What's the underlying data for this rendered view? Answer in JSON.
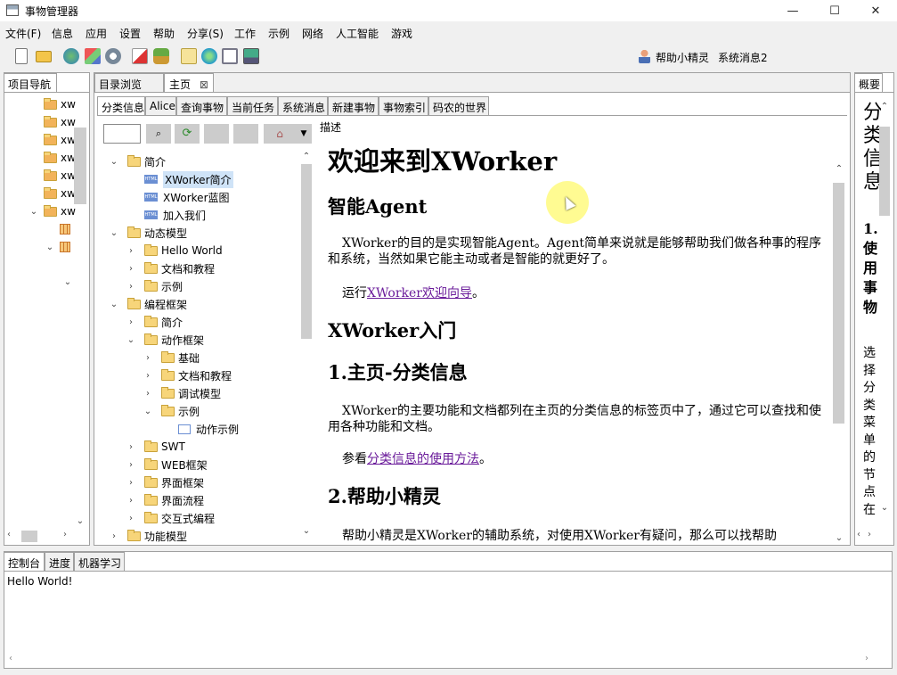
{
  "window": {
    "title": "事物管理器",
    "minimize": "—",
    "maximize": "☐",
    "close": "✕"
  },
  "menu": [
    "文件(F)",
    "信息",
    "应用",
    "设置",
    "帮助",
    "分享(S)",
    "工作",
    "示例",
    "网络",
    "人工智能",
    "游戏"
  ],
  "toolbar_right": {
    "helper": "帮助小精灵",
    "messages": "系统消息2"
  },
  "project_nav": {
    "tab": "项目导航",
    "items": [
      "xw",
      "xw",
      "xw",
      "xw",
      "xw",
      "xw",
      "xw"
    ]
  },
  "center_tabs": {
    "tab1": "目录浏览",
    "tab2": "主页",
    "tab2_close": "⊠"
  },
  "sub_tabs": [
    "分类信息",
    "Alice",
    "查询事物",
    "当前任务",
    "系统消息",
    "新建事物",
    "事物索引",
    "码农的世界"
  ],
  "tree": [
    {
      "label": "简介",
      "type": "folder",
      "level": 0,
      "state": "open"
    },
    {
      "label": "XWorker简介",
      "type": "html",
      "level": 1,
      "state": "leaf",
      "selected": true
    },
    {
      "label": "XWorker蓝图",
      "type": "html",
      "level": 1,
      "state": "leaf"
    },
    {
      "label": "加入我们",
      "type": "html",
      "level": 1,
      "state": "leaf"
    },
    {
      "label": "动态模型",
      "type": "folder",
      "level": 0,
      "state": "open"
    },
    {
      "label": "Hello World",
      "type": "folder",
      "level": 1,
      "state": "closed"
    },
    {
      "label": "文档和教程",
      "type": "folder",
      "level": 1,
      "state": "closed"
    },
    {
      "label": "示例",
      "type": "folder",
      "level": 1,
      "state": "closed"
    },
    {
      "label": "编程框架",
      "type": "folder",
      "level": 0,
      "state": "open"
    },
    {
      "label": "简介",
      "type": "folder",
      "level": 1,
      "state": "closed"
    },
    {
      "label": "动作框架",
      "type": "folder",
      "level": 1,
      "state": "open"
    },
    {
      "label": "基础",
      "type": "folder",
      "level": 2,
      "state": "closed"
    },
    {
      "label": "文档和教程",
      "type": "folder",
      "level": 2,
      "state": "closed"
    },
    {
      "label": "调试模型",
      "type": "folder",
      "level": 2,
      "state": "closed"
    },
    {
      "label": "示例",
      "type": "folder",
      "level": 2,
      "state": "open"
    },
    {
      "label": "动作示例",
      "type": "doc",
      "level": 3,
      "state": "leaf"
    },
    {
      "label": "SWT",
      "type": "folder",
      "level": 1,
      "state": "closed"
    },
    {
      "label": "WEB框架",
      "type": "folder",
      "level": 1,
      "state": "closed"
    },
    {
      "label": "界面框架",
      "type": "folder",
      "level": 1,
      "state": "closed"
    },
    {
      "label": "界面流程",
      "type": "folder",
      "level": 1,
      "state": "closed"
    },
    {
      "label": "交互式编程",
      "type": "folder",
      "level": 1,
      "state": "closed"
    },
    {
      "label": "功能模型",
      "type": "folder",
      "level": 0,
      "state": "closed"
    }
  ],
  "content": {
    "desc_label": "描述",
    "h1": "欢迎来到XWorker",
    "h2_agent": "智能Agent",
    "p_agent": "XWorker的目的是实现智能Agent。Agent简单来说就是能够帮助我们做各种事的程序和系统，当然如果它能主动或者是智能的就更好了。",
    "run_prefix": "运行",
    "run_link": "XWorker欢迎向导",
    "period": "。",
    "h2_intro": "XWorker入门",
    "h3_home": "1.主页-分类信息",
    "p_home": "XWorker的主要功能和文档都列在主页的分类信息的标签页中了，通过它可以查找和使用各种功能和文档。",
    "see_prefix": "参看",
    "see_link": "分类信息的使用方法",
    "h3_helper": "2.帮助小精灵",
    "p_helper": "帮助小精灵是XWorker的辅助系统，对使用XWorker有疑问，那么可以找帮助"
  },
  "overview": {
    "tab": "概要",
    "heading_chars": [
      "分",
      "类",
      "信",
      "息"
    ],
    "item_chars": [
      "1.",
      "使",
      "用",
      "事",
      "物"
    ],
    "body_chars": [
      "选",
      "择",
      "分",
      "类",
      "菜",
      "单",
      "的",
      "节",
      "点",
      "在"
    ]
  },
  "bottom": {
    "tabs": [
      "控制台",
      "进度",
      "机器学习"
    ],
    "console_text": "Hello World!"
  },
  "colors": {
    "link": "#6a1b9a",
    "highlight": "#ffff66",
    "selected": "#cfe3f7"
  }
}
